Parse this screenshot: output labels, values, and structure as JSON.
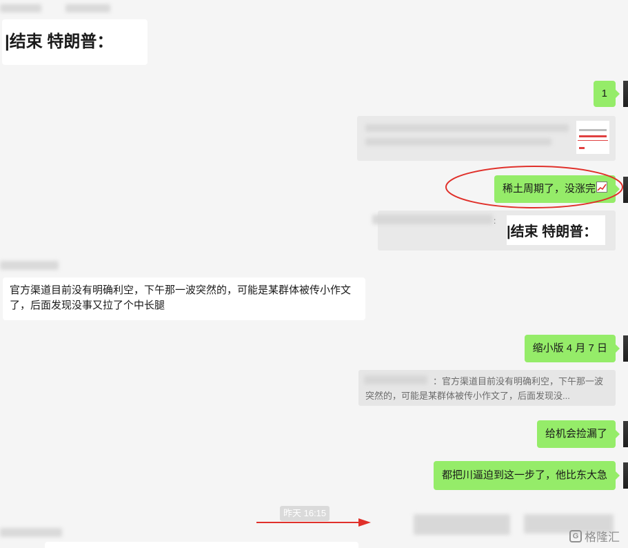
{
  "chat": {
    "top_card": {
      "headline": "|结束 特朗普："
    },
    "messages": [
      {
        "id": "m1",
        "side": "right",
        "text": "1"
      },
      {
        "id": "m2",
        "side": "right",
        "type": "link_card"
      },
      {
        "id": "m3",
        "side": "right",
        "text": "稀土周期了，没涨完",
        "emoji": "chart-increasing-icon"
      },
      {
        "id": "m4",
        "side": "right",
        "type": "quote_image",
        "headline": "|结束 特朗普："
      },
      {
        "id": "m5",
        "side": "left",
        "text": "官方渠道目前没有明确利空，下午那一波突然的，可能是某群体被传小作文了，后面发现没事又拉了个中长腿"
      },
      {
        "id": "m6",
        "side": "right",
        "text": "缩小版 4 月 7 日"
      },
      {
        "id": "m7",
        "side": "right",
        "type": "quote",
        "text": "：官方渠道目前没有明确利空，下午那一波突然的，可能是某群体被传小作文了，后面发现没..."
      },
      {
        "id": "m8",
        "side": "right",
        "text": "给机会捡漏了"
      },
      {
        "id": "m9",
        "side": "right",
        "text": "都把川逼迫到这一步了，他比东大急"
      }
    ],
    "timestamp": "昨天 16:15"
  },
  "annotation": {
    "ellipse_color": "#e0302a",
    "arrow_color": "#e0302a"
  },
  "watermark": {
    "text": "格隆汇"
  },
  "colors": {
    "background": "#f5f5f5",
    "green_bubble": "#95ec69",
    "white_bubble": "#ffffff"
  }
}
